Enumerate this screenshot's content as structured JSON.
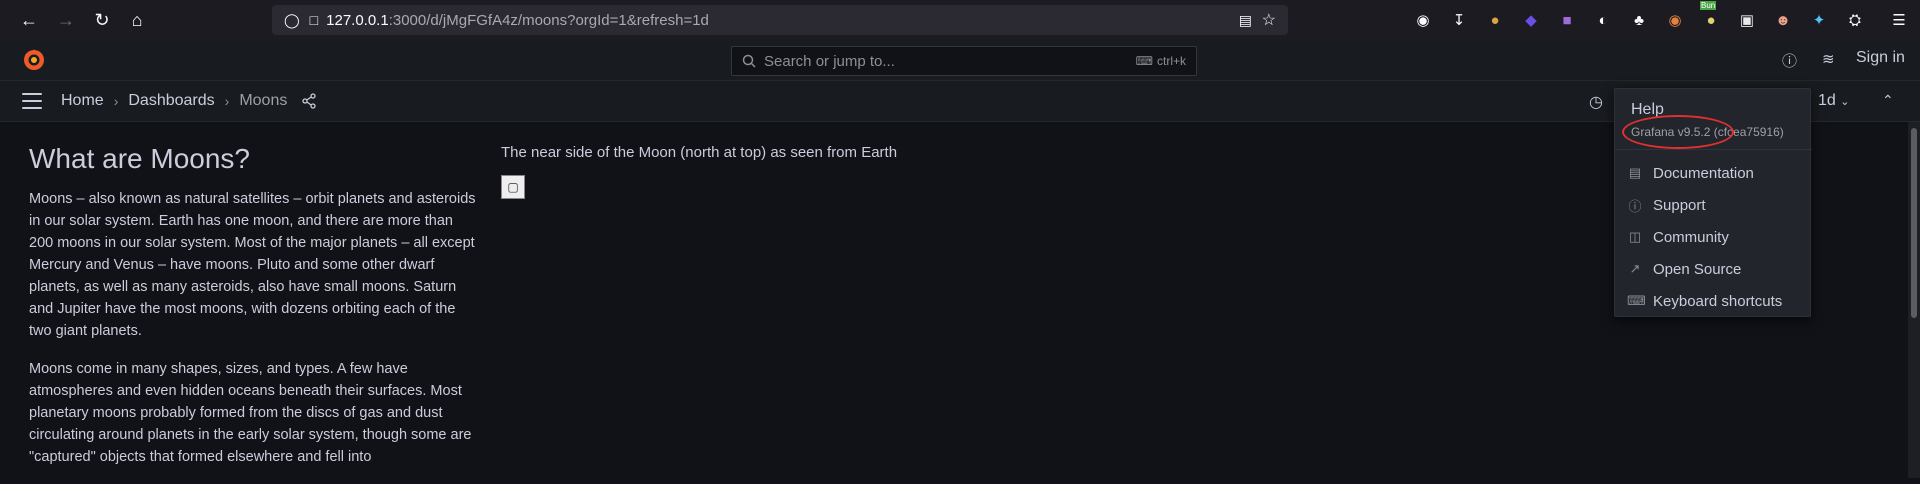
{
  "browser": {
    "url_host": "127.0.0.1",
    "url_rest": ":3000/d/jMgFGfA4z/moons?orgId=1&refresh=1d",
    "extension_badge": "Bun"
  },
  "topbar": {
    "search_placeholder": "Search or jump to...",
    "search_shortcut": "ctrl+k",
    "signin_label": "Sign in"
  },
  "navbar": {
    "breadcrumbs": [
      "Home",
      "Dashboards",
      "Moons"
    ],
    "refresh_interval": "1d"
  },
  "text_panel": {
    "heading": "What are Moons?",
    "paragraph1": "Moons – also known as natural satellites – orbit planets and asteroids in our solar system. Earth has one moon, and there are more than 200 moons in our solar system. Most of the major planets – all except Mercury and Venus – have moons. Pluto and some other dwarf planets, as well as many asteroids, also have small moons. Saturn and Jupiter have the most moons, with dozens orbiting each of the two giant planets.",
    "paragraph2": "Moons come in many shapes, sizes, and types. A few have atmospheres and even hidden oceans beneath their surfaces. Most planetary moons probably formed from the discs of gas and dust circulating around planets in the early solar system, though some are \"captured\" objects that formed elsewhere and fell into"
  },
  "image_panel": {
    "title": "The near side of the Moon (north at top) as seen from Earth"
  },
  "help_menu": {
    "title": "Help",
    "version": "Grafana v9.5.2 (cfcea75916)",
    "items": [
      {
        "label": "Documentation",
        "icon": "document-icon"
      },
      {
        "label": "Support",
        "icon": "question-circle-icon"
      },
      {
        "label": "Community",
        "icon": "comments-icon"
      },
      {
        "label": "Open Source",
        "icon": "external-link-icon"
      },
      {
        "label": "Keyboard shortcuts",
        "icon": "keyboard-icon"
      }
    ]
  },
  "colors": {
    "background": "#111217",
    "panel": "#181b1f",
    "menu": "#22252b",
    "annotation": "#e03030",
    "grafana_orange": "#f05a28"
  }
}
